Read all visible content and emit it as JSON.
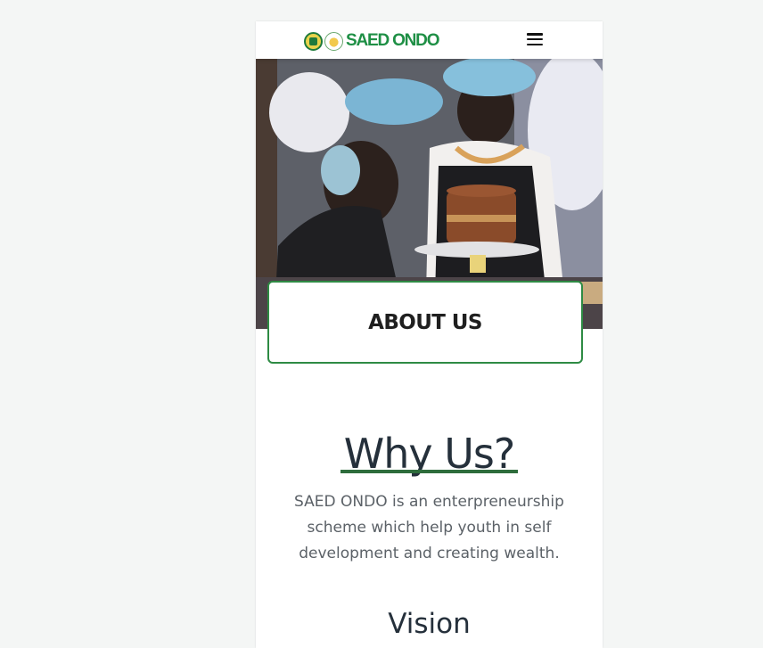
{
  "navbar": {
    "brand_text": "SAED ONDO",
    "logo_icons": [
      "nysc-emblem-icon",
      "saed-logo-icon"
    ],
    "menu_icon": "hamburger-menu-icon"
  },
  "hero": {
    "image_description_icon": "bakers-decorating-cake-photo"
  },
  "about": {
    "title": "ABOUT US"
  },
  "why_us": {
    "title": "Why Us?",
    "text": "SAED ONDO is an enterpreneurship scheme which help youth in self development and creating wealth."
  },
  "vision": {
    "title": "Vision"
  },
  "colors": {
    "brand_green": "#1e8f45",
    "border_green": "#2e8b44",
    "underline_green": "#2e6d3c",
    "heading_dark": "#25303b",
    "body_text": "#5b6167"
  }
}
